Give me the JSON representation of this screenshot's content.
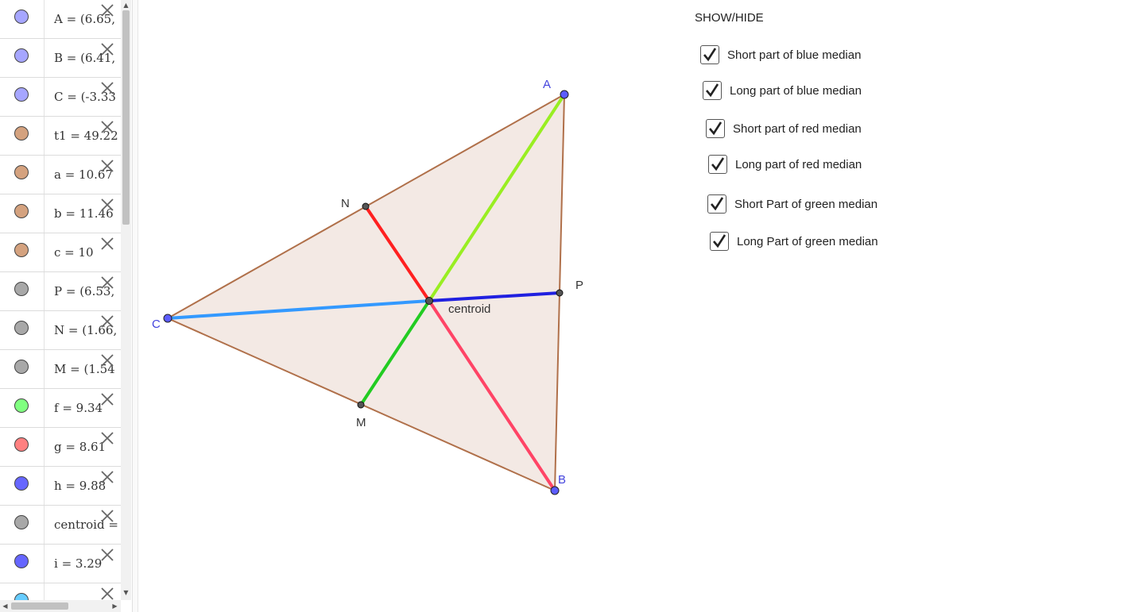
{
  "algebra": {
    "rows": [
      {
        "text": "A = (6.65,",
        "color": "#a6a6ff"
      },
      {
        "text": "B = (6.41,",
        "color": "#a6a6ff"
      },
      {
        "text": "C = (-3.33",
        "color": "#a6a6ff"
      },
      {
        "text": "t1 = 49.22",
        "color": "#d4a27f"
      },
      {
        "text": "a = 10.67",
        "color": "#d4a27f"
      },
      {
        "text": "b = 11.46",
        "color": "#d4a27f"
      },
      {
        "text": "c = 10",
        "color": "#d4a27f"
      },
      {
        "text": "P = (6.53,",
        "color": "#a8a8a8"
      },
      {
        "text": "N = (1.66,",
        "color": "#a8a8a8"
      },
      {
        "text": "M = (1.54",
        "color": "#a8a8a8"
      },
      {
        "text": "f = 9.34",
        "color": "#80ff80"
      },
      {
        "text": "g = 8.61",
        "color": "#ff8080"
      },
      {
        "text": "h = 9.88",
        "color": "#6666ff"
      },
      {
        "text": "centroid =",
        "color": "#a8a8a8"
      },
      {
        "text": "i = 3.29",
        "color": "#6666ff"
      },
      {
        "text": "",
        "color": "#66ccff"
      }
    ]
  },
  "graphics": {
    "labels": {
      "A": "A",
      "B": "B",
      "C": "C",
      "N": "N",
      "M": "M",
      "P": "P",
      "centroid": "centroid"
    },
    "colors": {
      "triangle_fill": "#f3e9e4",
      "triangle_edge": "#b0704a",
      "vertex": "#5c5cff",
      "midpoint": "#555555",
      "blue_short": "#2020e0",
      "blue_long": "#3399ff",
      "red_short": "#ff2020",
      "red_long": "#ff4466",
      "green_short": "#99ee22",
      "green_long": "#22cc22",
      "vertex_label": "#4444dd"
    }
  },
  "showhide": {
    "title": "SHOW/HIDE",
    "items": [
      {
        "label": "Short part of blue median",
        "checked": true
      },
      {
        "label": "Long part of blue median",
        "checked": true
      },
      {
        "label": "Short part of red median",
        "checked": true
      },
      {
        "label": "Long part of red median",
        "checked": true
      },
      {
        "label": "Short Part of green median",
        "checked": true
      },
      {
        "label": "Long Part of green median",
        "checked": true
      }
    ]
  }
}
